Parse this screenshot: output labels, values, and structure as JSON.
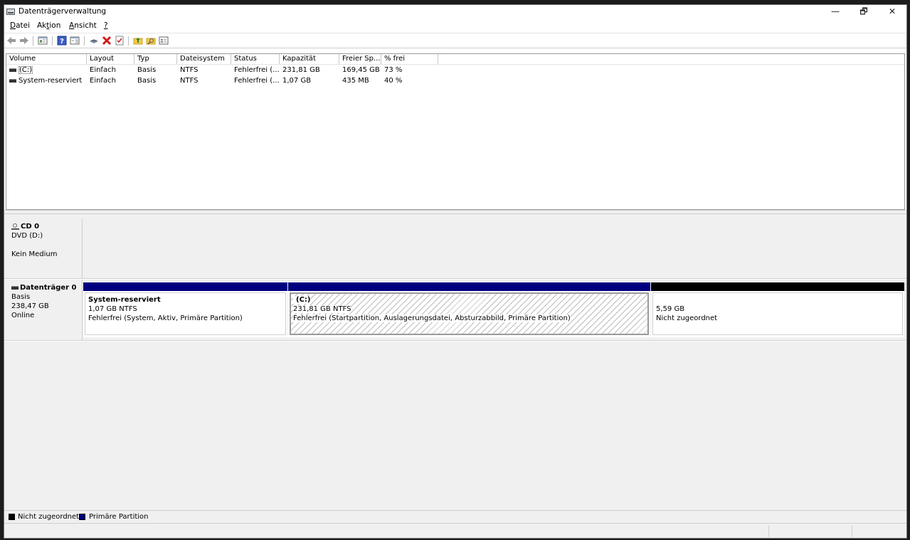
{
  "window": {
    "title": "Datenträgerverwaltung",
    "minimize": "—",
    "restore": "🗗",
    "close": "✕"
  },
  "menu": {
    "items": [
      {
        "id": "datei",
        "underline": "D",
        "rest": "atei"
      },
      {
        "id": "aktion",
        "pre": "Ak",
        "underline": "t",
        "rest": "ion"
      },
      {
        "id": "ansicht",
        "underline": "A",
        "rest": "nsicht"
      },
      {
        "id": "help",
        "underline": "?",
        "rest": ""
      }
    ]
  },
  "toolbar": {
    "icons": [
      "back-arrow-icon",
      "forward-arrow-icon",
      "console-tree-icon",
      "help-icon",
      "properties-pane-icon",
      "connect-icon",
      "delete-icon",
      "checklist-icon",
      "folder-up-icon",
      "folder-search-icon",
      "properties-icon"
    ]
  },
  "volumes": {
    "columns": [
      "Volume",
      "Layout",
      "Typ",
      "Dateisystem",
      "Status",
      "Kapazität",
      "Freier Sp...",
      "% frei"
    ],
    "rows": [
      {
        "volume": "(C:)",
        "layout": "Einfach",
        "typ": "Basis",
        "fs": "NTFS",
        "status": "Fehlerfrei (...",
        "cap": "231,81 GB",
        "free": "169,45 GB",
        "pct": "73 %"
      },
      {
        "volume": "System-reserviert",
        "layout": "Einfach",
        "typ": "Basis",
        "fs": "NTFS",
        "status": "Fehlerfrei (...",
        "cap": "1,07 GB",
        "free": "435 MB",
        "pct": "40 %"
      }
    ]
  },
  "disks": {
    "cd0": {
      "name": "CD 0",
      "type": "DVD (D:)",
      "media": "Kein Medium"
    },
    "disk0": {
      "name": "Datenträger 0",
      "type": "Basis",
      "size": "238,47 GB",
      "state": "Online",
      "partitions": [
        {
          "title": "System-reserviert",
          "size": "1,07 GB NTFS",
          "status": "Fehlerfrei (System, Aktiv, Primäre Partition)"
        },
        {
          "title": "(C:)",
          "size": "231,81 GB NTFS",
          "status": "Fehlerfrei (Startpartition, Auslagerungsdatei, Absturzabbild, Primäre Partition)"
        },
        {
          "title": "",
          "size": "5,59 GB",
          "status": "Nicht zugeordnet"
        }
      ]
    }
  },
  "legend": {
    "unallocated": {
      "label": "Nicht zugeordnet",
      "color": "#000000"
    },
    "primary": {
      "label": "Primäre Partition",
      "color": "#00007f"
    }
  }
}
